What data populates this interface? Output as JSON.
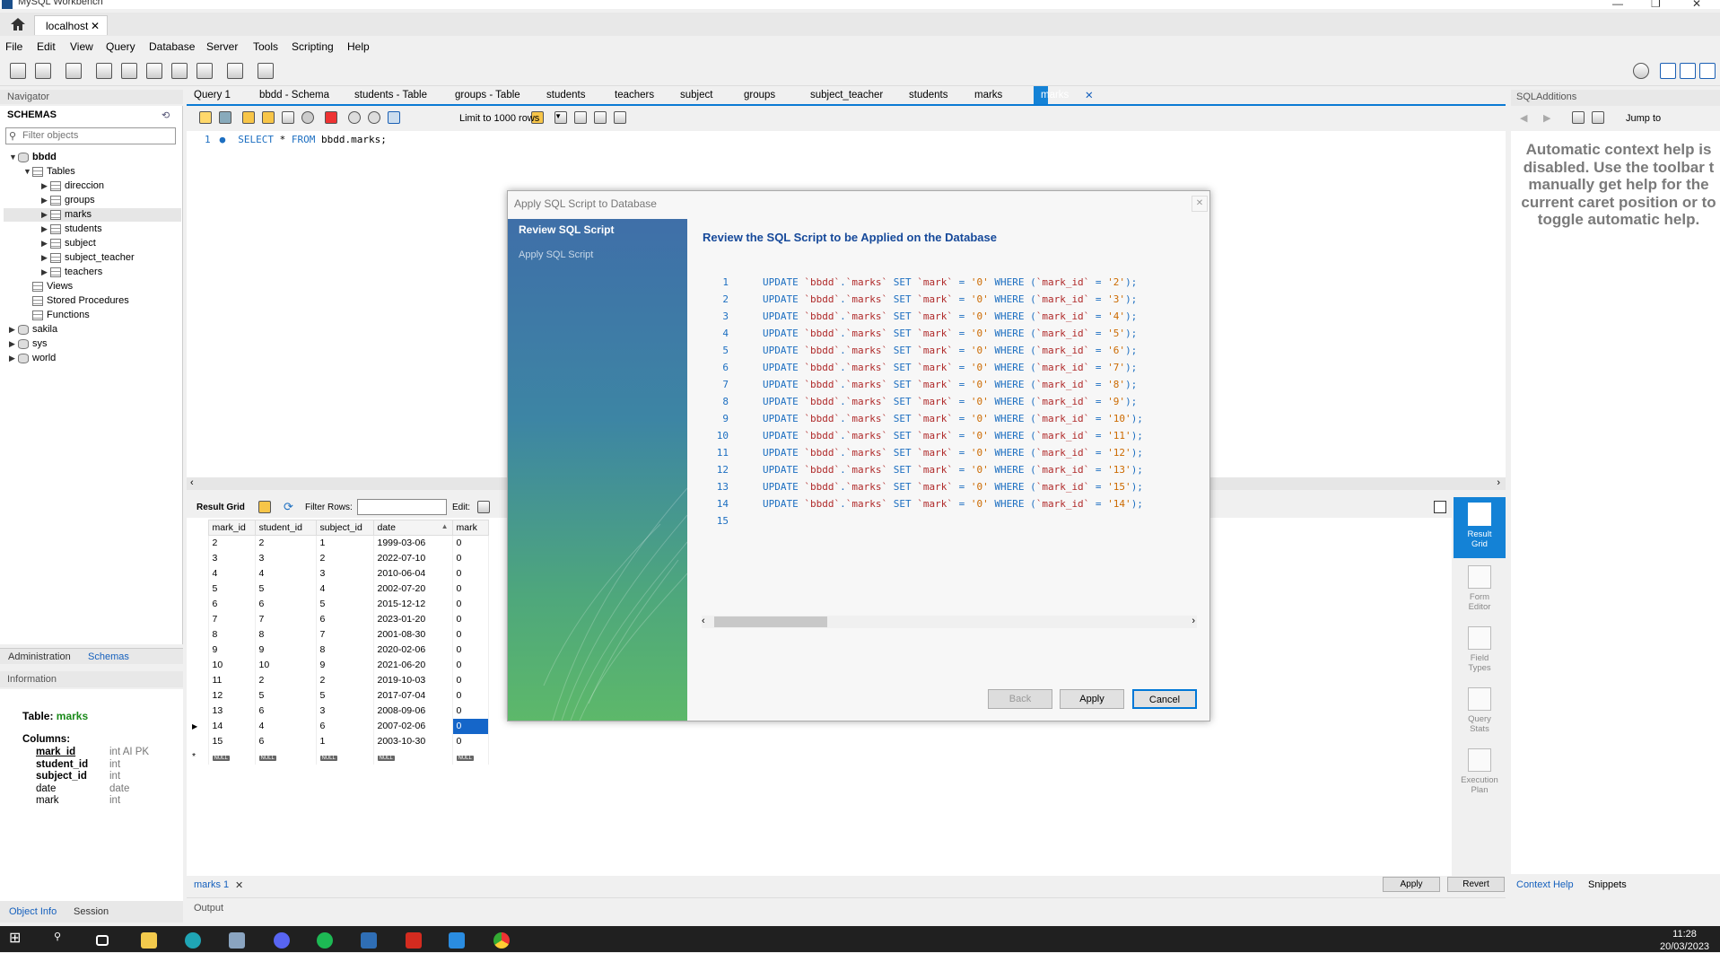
{
  "app": {
    "title": "MySQL Workbench"
  },
  "connection_tab": {
    "label": "localhost"
  },
  "menu": [
    "File",
    "Edit",
    "View",
    "Query",
    "Database",
    "Server",
    "Tools",
    "Scripting",
    "Help"
  ],
  "navigator": {
    "header": "Navigator",
    "schemas_label": "SCHEMAS",
    "filter_placeholder": "Filter objects",
    "tree": {
      "db1": "bbdd",
      "tables": "Tables",
      "tables_list": [
        "direccion",
        "groups",
        "marks",
        "students",
        "subject",
        "subject_teacher",
        "teachers"
      ],
      "views": "Views",
      "procs": "Stored Procedures",
      "funcs": "Functions",
      "other_dbs": [
        "sakila",
        "sys",
        "world"
      ]
    },
    "tabs": {
      "admin": "Administration",
      "schemas": "Schemas"
    }
  },
  "information": {
    "header": "Information",
    "table_label": "Table:",
    "table_name": "marks",
    "columns_label": "Columns:",
    "columns": [
      {
        "name": "mark_id",
        "type": "int AI PK"
      },
      {
        "name": "student_id",
        "type": "int"
      },
      {
        "name": "subject_id",
        "type": "int"
      },
      {
        "name": "date",
        "type": "date"
      },
      {
        "name": "mark",
        "type": "int"
      }
    ],
    "bottom_tabs": {
      "info": "Object Info",
      "session": "Session"
    }
  },
  "editor_tabs": [
    "Query 1",
    "bbdd - Schema",
    "students - Table",
    "groups - Table",
    "students",
    "teachers",
    "subject",
    "groups",
    "subject_teacher",
    "students",
    "marks",
    "marks"
  ],
  "query_toolbar": {
    "limit": "Limit to 1000 rows"
  },
  "editor": {
    "line_no": "1",
    "keyword1": "SELECT",
    "rest": " * ",
    "keyword2": "FROM",
    "table": " bbdd.marks;"
  },
  "result_bar": {
    "result_grid": "Result Grid",
    "filter_rows": "Filter Rows:",
    "edit": "Edit:"
  },
  "grid": {
    "columns": [
      "mark_id",
      "student_id",
      "subject_id",
      "date",
      "mark"
    ],
    "rows": [
      [
        "2",
        "2",
        "1",
        "1999-03-06",
        "0"
      ],
      [
        "3",
        "3",
        "2",
        "2022-07-10",
        "0"
      ],
      [
        "4",
        "4",
        "3",
        "2010-06-04",
        "0"
      ],
      [
        "5",
        "5",
        "4",
        "2002-07-20",
        "0"
      ],
      [
        "6",
        "6",
        "5",
        "2015-12-12",
        "0"
      ],
      [
        "7",
        "7",
        "6",
        "2023-01-20",
        "0"
      ],
      [
        "8",
        "8",
        "7",
        "2001-08-30",
        "0"
      ],
      [
        "9",
        "9",
        "8",
        "2020-02-06",
        "0"
      ],
      [
        "10",
        "10",
        "9",
        "2021-06-20",
        "0"
      ],
      [
        "11",
        "2",
        "2",
        "2019-10-03",
        "0"
      ],
      [
        "12",
        "5",
        "5",
        "2017-07-04",
        "0"
      ],
      [
        "13",
        "6",
        "3",
        "2008-09-06",
        "0"
      ],
      [
        "14",
        "4",
        "6",
        "2007-02-06",
        "0"
      ],
      [
        "15",
        "6",
        "1",
        "2003-10-30",
        "0"
      ]
    ],
    "null_label": "NULL",
    "new_row_marker": "*"
  },
  "side_panel": {
    "result_grid": [
      "Result",
      "Grid"
    ],
    "form_editor": [
      "Form",
      "Editor"
    ],
    "field_types": [
      "Field",
      "Types"
    ],
    "query_stats": [
      "Query",
      "Stats"
    ],
    "execution_plan": [
      "Execution",
      "Plan"
    ]
  },
  "result_bottom": {
    "tab": "marks 1",
    "apply": "Apply",
    "revert": "Revert"
  },
  "output": {
    "label": "Output"
  },
  "sql_additions": {
    "header": "SQLAdditions",
    "jump_to": "Jump to",
    "help_lines": [
      "Automatic context help is",
      "disabled. Use the toolbar t",
      "manually get help for the",
      "current caret position or to",
      "toggle automatic help."
    ],
    "tabs": {
      "context_help": "Context Help",
      "snippets": "Snippets"
    }
  },
  "dialog": {
    "title": "Apply SQL Script to Database",
    "close": "✕",
    "steps": [
      "Review SQL Script",
      "Apply SQL Script"
    ],
    "heading": "Review the SQL Script to be Applied on the Database",
    "script_ids": [
      "2",
      "3",
      "4",
      "5",
      "6",
      "7",
      "8",
      "9",
      "10",
      "11",
      "12",
      "13",
      "15",
      "14"
    ],
    "last_line": "15",
    "buttons": {
      "back": "Back",
      "apply": "Apply",
      "cancel": "Cancel"
    }
  },
  "taskbar": {
    "time": "11:28",
    "date": "20/03/2023"
  }
}
